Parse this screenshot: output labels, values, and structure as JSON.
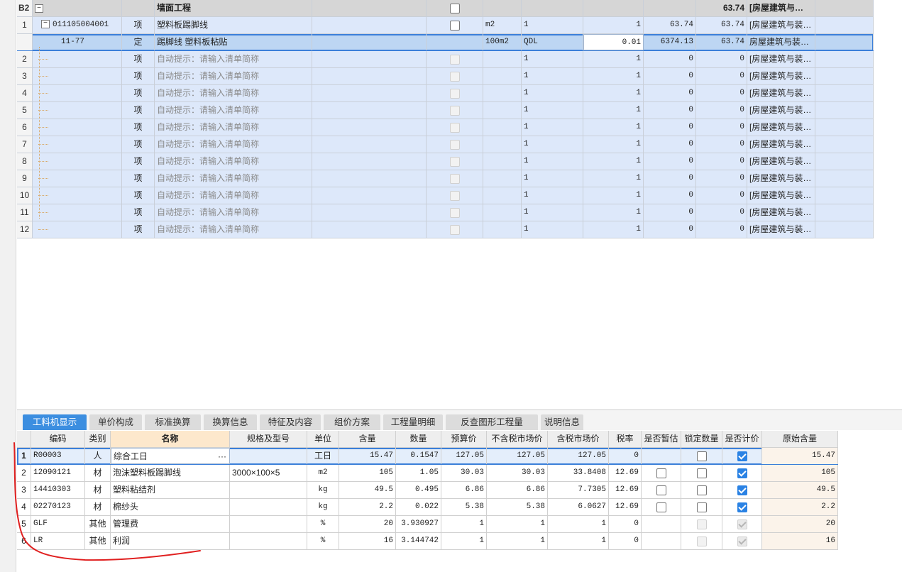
{
  "top_grid": {
    "group": {
      "id": "B2",
      "name": "墙面工程",
      "total": "63.74",
      "tail": "[房屋建筑与…"
    },
    "item": {
      "num": "1",
      "code": "011105004001",
      "type": "项",
      "name": "塑料板踢脚线",
      "unit": "m2",
      "expr": "1",
      "qty": "1",
      "price": "63.74",
      "total": "63.74",
      "spec": "[房屋建筑与装…"
    },
    "quota": {
      "code": "11-77",
      "type": "定",
      "name": "踢脚线 塑料板粘贴",
      "unit": "100m2",
      "expr": "QDL",
      "qty": "0.01",
      "price": "6374.13",
      "total": "63.74",
      "spec": "房屋建筑与装…"
    },
    "empty_rows": [
      {
        "num": "2",
        "type": "项",
        "name": "自动提示：请输入清单简称",
        "expr": "1",
        "qty": "1",
        "price": "0",
        "total": "0",
        "spec": "[房屋建筑与装…"
      },
      {
        "num": "3",
        "type": "项",
        "name": "自动提示：请输入清单简称",
        "expr": "1",
        "qty": "1",
        "price": "0",
        "total": "0",
        "spec": "[房屋建筑与装…"
      },
      {
        "num": "4",
        "type": "项",
        "name": "自动提示：请输入清单简称",
        "expr": "1",
        "qty": "1",
        "price": "0",
        "total": "0",
        "spec": "[房屋建筑与装…"
      },
      {
        "num": "5",
        "type": "项",
        "name": "自动提示：请输入清单简称",
        "expr": "1",
        "qty": "1",
        "price": "0",
        "total": "0",
        "spec": "[房屋建筑与装…"
      },
      {
        "num": "6",
        "type": "项",
        "name": "自动提示：请输入清单简称",
        "expr": "1",
        "qty": "1",
        "price": "0",
        "total": "0",
        "spec": "[房屋建筑与装…"
      },
      {
        "num": "7",
        "type": "项",
        "name": "自动提示：请输入清单简称",
        "expr": "1",
        "qty": "1",
        "price": "0",
        "total": "0",
        "spec": "[房屋建筑与装…"
      },
      {
        "num": "8",
        "type": "项",
        "name": "自动提示：请输入清单简称",
        "expr": "1",
        "qty": "1",
        "price": "0",
        "total": "0",
        "spec": "[房屋建筑与装…"
      },
      {
        "num": "9",
        "type": "项",
        "name": "自动提示：请输入清单简称",
        "expr": "1",
        "qty": "1",
        "price": "0",
        "total": "0",
        "spec": "[房屋建筑与装…"
      },
      {
        "num": "10",
        "type": "项",
        "name": "自动提示：请输入清单简称",
        "expr": "1",
        "qty": "1",
        "price": "0",
        "total": "0",
        "spec": "[房屋建筑与装…"
      },
      {
        "num": "11",
        "type": "项",
        "name": "自动提示：请输入清单简称",
        "expr": "1",
        "qty": "1",
        "price": "0",
        "total": "0",
        "spec": "[房屋建筑与装…"
      },
      {
        "num": "12",
        "type": "项",
        "name": "自动提示：请输入清单简称",
        "expr": "1",
        "qty": "1",
        "price": "0",
        "total": "0",
        "spec": "[房屋建筑与装…"
      }
    ]
  },
  "tabs": [
    "工料机显示",
    "单价构成",
    "标准换算",
    "换算信息",
    "特征及内容",
    "组价方案",
    "工程量明细",
    "反查图形工程量",
    "说明信息"
  ],
  "bottom_grid": {
    "headers": [
      "编码",
      "类别",
      "名称",
      "规格及型号",
      "单位",
      "含量",
      "数量",
      "预算价",
      "不含税市场价",
      "含税市场价",
      "税率",
      "是否暂估",
      "锁定数量",
      "是否计价",
      "原始含量"
    ],
    "rows": [
      {
        "num": "1",
        "code": "R00003",
        "cat": "人",
        "name": "综合工日",
        "spec": "",
        "unit": "工日",
        "content": "15.47",
        "qty": "0.1547",
        "budget": "127.05",
        "notax": "127.05",
        "tax": "127.05",
        "rate": "0",
        "orig": "15.47"
      },
      {
        "num": "2",
        "code": "12090121",
        "cat": "材",
        "name": "泡沫塑料板踢脚线",
        "spec": "3000×100×5",
        "unit": "m2",
        "content": "105",
        "qty": "1.05",
        "budget": "30.03",
        "notax": "30.03",
        "tax": "33.8408",
        "rate": "12.69",
        "orig": "105"
      },
      {
        "num": "3",
        "code": "14410303",
        "cat": "材",
        "name": "塑料粘结剂",
        "spec": "",
        "unit": "kg",
        "content": "49.5",
        "qty": "0.495",
        "budget": "6.86",
        "notax": "6.86",
        "tax": "7.7305",
        "rate": "12.69",
        "orig": "49.5"
      },
      {
        "num": "4",
        "code": "02270123",
        "cat": "材",
        "name": "棉纱头",
        "spec": "",
        "unit": "kg",
        "content": "2.2",
        "qty": "0.022",
        "budget": "5.38",
        "notax": "5.38",
        "tax": "6.0627",
        "rate": "12.69",
        "orig": "2.2"
      },
      {
        "num": "5",
        "code": "GLF",
        "cat": "其他",
        "name": "管理费",
        "spec": "",
        "unit": "%",
        "content": "20",
        "qty": "3.930927",
        "budget": "1",
        "notax": "1",
        "tax": "1",
        "rate": "0",
        "orig": "20"
      },
      {
        "num": "6",
        "code": "LR",
        "cat": "其他",
        "name": "利润",
        "spec": "",
        "unit": "%",
        "content": "16",
        "qty": "3.144742",
        "budget": "1",
        "notax": "1",
        "tax": "1",
        "rate": "0",
        "orig": "16"
      }
    ],
    "ellipsis": "···"
  },
  "colors": {
    "accent": "#3c8ee0",
    "row_fill": "#dde8fa",
    "annotation": "#e02020"
  }
}
